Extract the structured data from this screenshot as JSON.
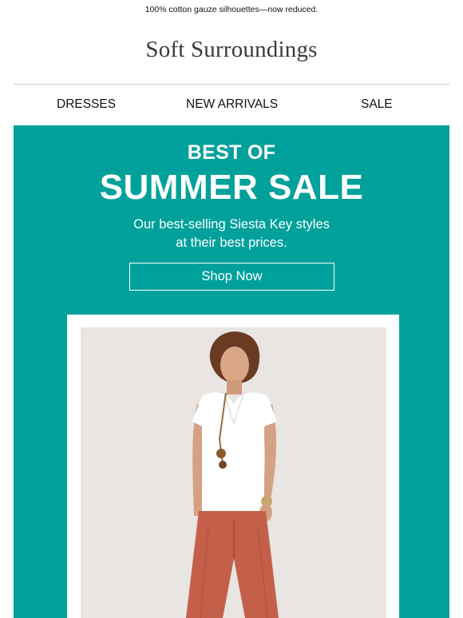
{
  "preheader": "100% cotton gauze silhouettes—now reduced.",
  "brand": {
    "logo_text": "Soft Surroundings"
  },
  "nav": {
    "items": [
      {
        "label": "DRESSES"
      },
      {
        "label": "NEW ARRIVALS"
      },
      {
        "label": "SALE"
      }
    ]
  },
  "hero": {
    "eyebrow": "BEST OF",
    "title": "SUMMER SALE",
    "subtitle_line1": "Our best-selling Siesta Key styles",
    "subtitle_line2": "at their best prices.",
    "cta_label": "Shop Now",
    "background_color": "#00a19b"
  },
  "product_image": {
    "description": "Model wearing white v-neck tee and rust wide-leg pants",
    "colors": {
      "top": "#ffffff",
      "pants": "#c4604a",
      "backdrop": "#ebe8e5"
    }
  }
}
